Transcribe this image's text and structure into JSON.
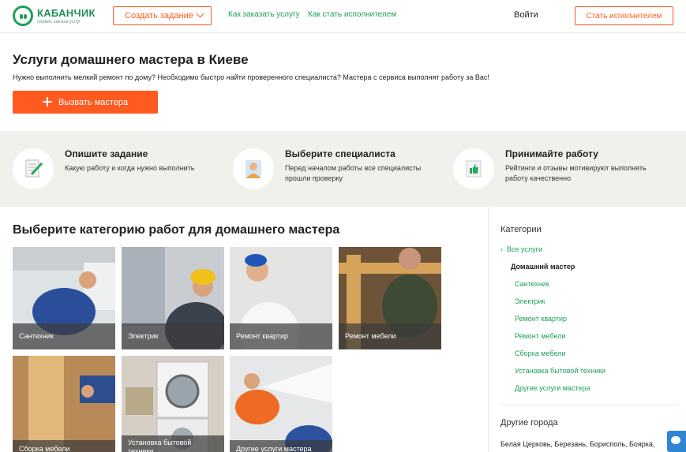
{
  "header": {
    "logo_name": "КАБАНЧИК",
    "logo_tagline": "сервис заказа услуг",
    "create_task": "Создать задание",
    "nav_how_order": "Как заказать услугу",
    "nav_how_become": "Как стать исполнителем",
    "login": "Войти",
    "become_executor": "Стать исполнителем"
  },
  "hero": {
    "title": "Услуги домашнего мастера в Киеве",
    "description": "Нужно выполнить мелкий ремонт по дому? Необходимо быстро найти проверенного специалиста? Мастера с сервиса выполнят работу за Вас!",
    "cta": "Вызвать мастера"
  },
  "steps": [
    {
      "title": "Опишите задание",
      "desc": "Какую работу и когда нужно выполнить",
      "icon": "edit-document-icon"
    },
    {
      "title": "Выберите специалиста",
      "desc": "Перед началом работы все специалисты прошли проверку",
      "icon": "specialist-avatar-icon"
    },
    {
      "title": "Принимайте работу",
      "desc": "Рейтинги и отзывы мотивируют выполнять работу качественно",
      "icon": "thumbs-up-icon"
    }
  ],
  "categories": {
    "title": "Выберите категорию работ для домашнего мастера",
    "tiles": [
      {
        "label": "Сантехник"
      },
      {
        "label": "Электрик"
      },
      {
        "label": "Ремонт квартир"
      },
      {
        "label": "Ремонт мебели"
      },
      {
        "label": "Сборка мебели"
      },
      {
        "label": "Установка бытовой техники"
      },
      {
        "label": "Другие услуги мастера"
      }
    ]
  },
  "sidebar": {
    "heading": "Категории",
    "back": "Все услуги",
    "active": "Домашний мастер",
    "items": [
      "Сантехник",
      "Электрик",
      "Ремонт квартир",
      "Ремонт мебели",
      "Сборка мебели",
      "Установка бытовой техники",
      "Другие услуги мастера"
    ],
    "other_cities_heading": "Другие города",
    "cities": "Белая Церковь, Березань, Борисполь, Боярка,"
  },
  "colors": {
    "accent": "#ff5a1f",
    "brand_green": "#1da05c",
    "steps_bg": "#eff2ea"
  }
}
